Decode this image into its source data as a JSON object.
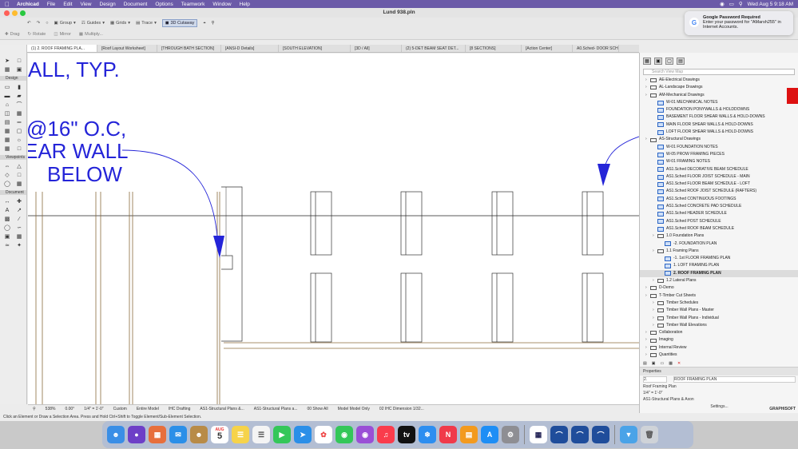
{
  "menubar": {
    "app": "Archicad",
    "items": [
      "File",
      "Edit",
      "View",
      "Design",
      "Document",
      "Options",
      "Teamwork",
      "Window",
      "Help"
    ],
    "clock": "Wed Aug 5  9:18 AM"
  },
  "window": {
    "title": "Lund 938.pln"
  },
  "toolbar1": {
    "items": [
      "Group",
      "Guides",
      "Grids",
      "Trace",
      "3D Cutaway"
    ]
  },
  "toolbar2": {
    "items": [
      "Drag",
      "Rotate",
      "Mirror",
      "Multiply..."
    ]
  },
  "tabs": [
    "(1) 2. ROOF FRAMING PLA...",
    "[Roof Layout Worksheet]",
    "[THROUGH BATH SECTION]",
    "[ANSI-D Details]",
    "[SOUTH ELEVATION]",
    "[3D / All]",
    "(2) 5-DET BEAM SEAT DET...",
    "[8 SECTIONS]",
    "[Action Center]",
    "A0.Sched- DOOR SCHEDU..."
  ],
  "toolbox": {
    "sections": [
      "Design",
      "Viewpoints",
      "Document"
    ]
  },
  "canvas": {
    "text_lines": [
      "ALL, TYP.",
      "@16\" O.C,",
      "EAR WALL",
      "BELOW"
    ]
  },
  "statusbar": {
    "items": [
      "538%",
      "0.00°",
      "1/4\"  =  1'-0\"",
      "Custom",
      "Entire Model",
      "IHC Drafting",
      "AS1-Structural Plans &...",
      "AS1-Structural Plans a...",
      "00 Show All",
      "Model Model Only",
      "02 IHC Dimension 1/32..."
    ]
  },
  "hint": "Click an Element or Draw a Selection Area. Press and Hold Ctrl+Shift to Toggle Element/Sub-Element Selection.",
  "navigator": {
    "search_placeholder": "Search View Map",
    "tree": [
      {
        "label": "AE-Electrical Drawings",
        "kind": "folder",
        "indent": 1
      },
      {
        "label": "AL-Landscape Drawings",
        "kind": "folder",
        "indent": 1
      },
      {
        "label": "AM-Mechanical Drawings",
        "kind": "folder",
        "indent": 1
      },
      {
        "label": "W-01 MECHANICAL NOTES",
        "kind": "layout",
        "indent": 2
      },
      {
        "label": "FOUNDATION PONYWALLS & HOLDDOWNS",
        "kind": "layout",
        "indent": 2
      },
      {
        "label": "BASEMENT FLOOR SHEAR WALLS & HOLD-DOWNS",
        "kind": "layout",
        "indent": 2
      },
      {
        "label": "MAIN FLOOR SHEAR WALLS & HOLD-DOWNS",
        "kind": "layout",
        "indent": 2
      },
      {
        "label": "LOFT FLOOR SHEAR WALLS & HOLD-DOWNS",
        "kind": "layout",
        "indent": 2
      },
      {
        "label": "AS-Structural Drawings",
        "kind": "folder",
        "indent": 1
      },
      {
        "label": "W-01 FOUNDATION NOTES",
        "kind": "layout",
        "indent": 2
      },
      {
        "label": "W-05 PROW FRAMING PIECES",
        "kind": "layout",
        "indent": 2
      },
      {
        "label": "W-01 FRAMING NOTES",
        "kind": "layout",
        "indent": 2
      },
      {
        "label": "AS1.Sched DECORATIVE BEAM SCHEDULE",
        "kind": "layout",
        "indent": 2
      },
      {
        "label": "AS1.Sched FLOOR JOIST SCHEDULE - MAIN",
        "kind": "layout",
        "indent": 2
      },
      {
        "label": "AS1.Sched FLOOR BEAM SCHEDULE - LOFT",
        "kind": "layout",
        "indent": 2
      },
      {
        "label": "AS1.Sched ROOF JOIST SCHEDULE (RAFTERS)",
        "kind": "layout",
        "indent": 2
      },
      {
        "label": "AS1.Sched CONTINUOUS FOOTINGS",
        "kind": "layout",
        "indent": 2
      },
      {
        "label": "AS1.Sched CONCRETE PAD SCHEDULE",
        "kind": "layout",
        "indent": 2
      },
      {
        "label": "AS1.Sched HEADER SCHEDULE",
        "kind": "layout",
        "indent": 2
      },
      {
        "label": "AS1.Sched POST SCHEDULE",
        "kind": "layout",
        "indent": 2
      },
      {
        "label": "AS1.Sched ROOF BEAM SCHEDULE",
        "kind": "layout",
        "indent": 2
      },
      {
        "label": "1.0 Foundation Plans",
        "kind": "folder",
        "indent": 2
      },
      {
        "label": "-2. FOUNDATION PLAN",
        "kind": "layout",
        "indent": 3
      },
      {
        "label": "1.1 Framing Plans",
        "kind": "folder",
        "indent": 2
      },
      {
        "label": "-1. 1st FLOOR FRAMING PLAN",
        "kind": "layout",
        "indent": 3
      },
      {
        "label": "1. LOFT FRAMING PLAN",
        "kind": "layout",
        "indent": 3
      },
      {
        "label": "2. ROOF FRAMING PLAN",
        "kind": "layout",
        "indent": 3,
        "selected": true
      },
      {
        "label": "1.2 Lateral Plans",
        "kind": "folder",
        "indent": 2
      },
      {
        "label": "D-Demo",
        "kind": "folder",
        "indent": 1
      },
      {
        "label": "T-Timber Cut Sheets",
        "kind": "folder",
        "indent": 1
      },
      {
        "label": "Timber Schedules",
        "kind": "folder",
        "indent": 2
      },
      {
        "label": "Timber Wall Plans - Master",
        "kind": "folder",
        "indent": 2
      },
      {
        "label": "Timber Wall Plans - Individual",
        "kind": "folder",
        "indent": 2
      },
      {
        "label": "Timber Wall Elevations",
        "kind": "folder",
        "indent": 2
      },
      {
        "label": "Collaboration",
        "kind": "folder",
        "indent": 1
      },
      {
        "label": "Imaging",
        "kind": "folder",
        "indent": 1
      },
      {
        "label": "Internal Review",
        "kind": "folder",
        "indent": 1
      },
      {
        "label": "Quantities",
        "kind": "folder",
        "indent": 1
      }
    ],
    "properties_title": "Properties",
    "prop_id": "2.",
    "prop_name": "ROOF FRAMING PLAN",
    "prop_view": "Roof Framing Plan",
    "prop_scale": "1/4\"  =  1'-0\"",
    "prop_set": "AS1-Structural Plans & Axon",
    "settings": "Settings...",
    "brand": "GRAPHISOFT"
  },
  "notification": {
    "title": "Google Password Required",
    "body": "Enter your password for \"AMarsh255\" in Internet Accounts."
  },
  "dock": {
    "calendar_month": "AUG",
    "calendar_day": "5"
  }
}
